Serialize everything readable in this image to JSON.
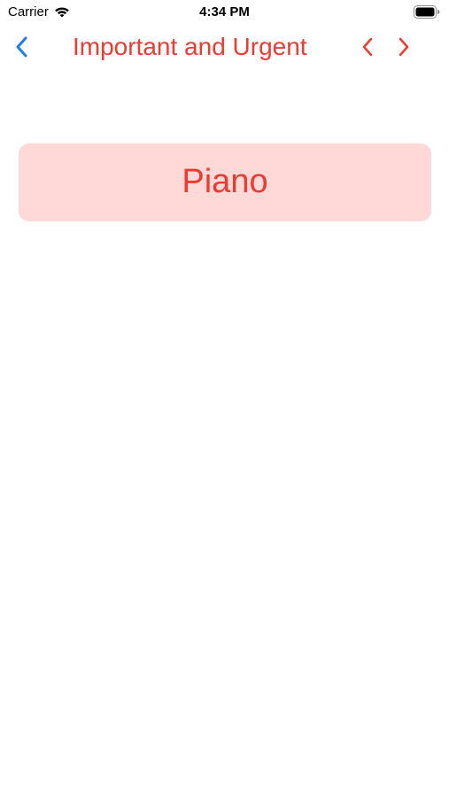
{
  "status_bar": {
    "carrier": "Carrier",
    "time": "4:34 PM"
  },
  "nav": {
    "title": "Important and Urgent",
    "back_icon": "chevron-left-icon",
    "prev_icon": "chevron-left-icon",
    "next_icon": "chevron-right-icon"
  },
  "tasks": [
    {
      "label": "Piano"
    }
  ],
  "colors": {
    "accent_red": "#ec3b32",
    "card_background": "#ffd9d7",
    "back_blue": "#1e7cf2"
  }
}
